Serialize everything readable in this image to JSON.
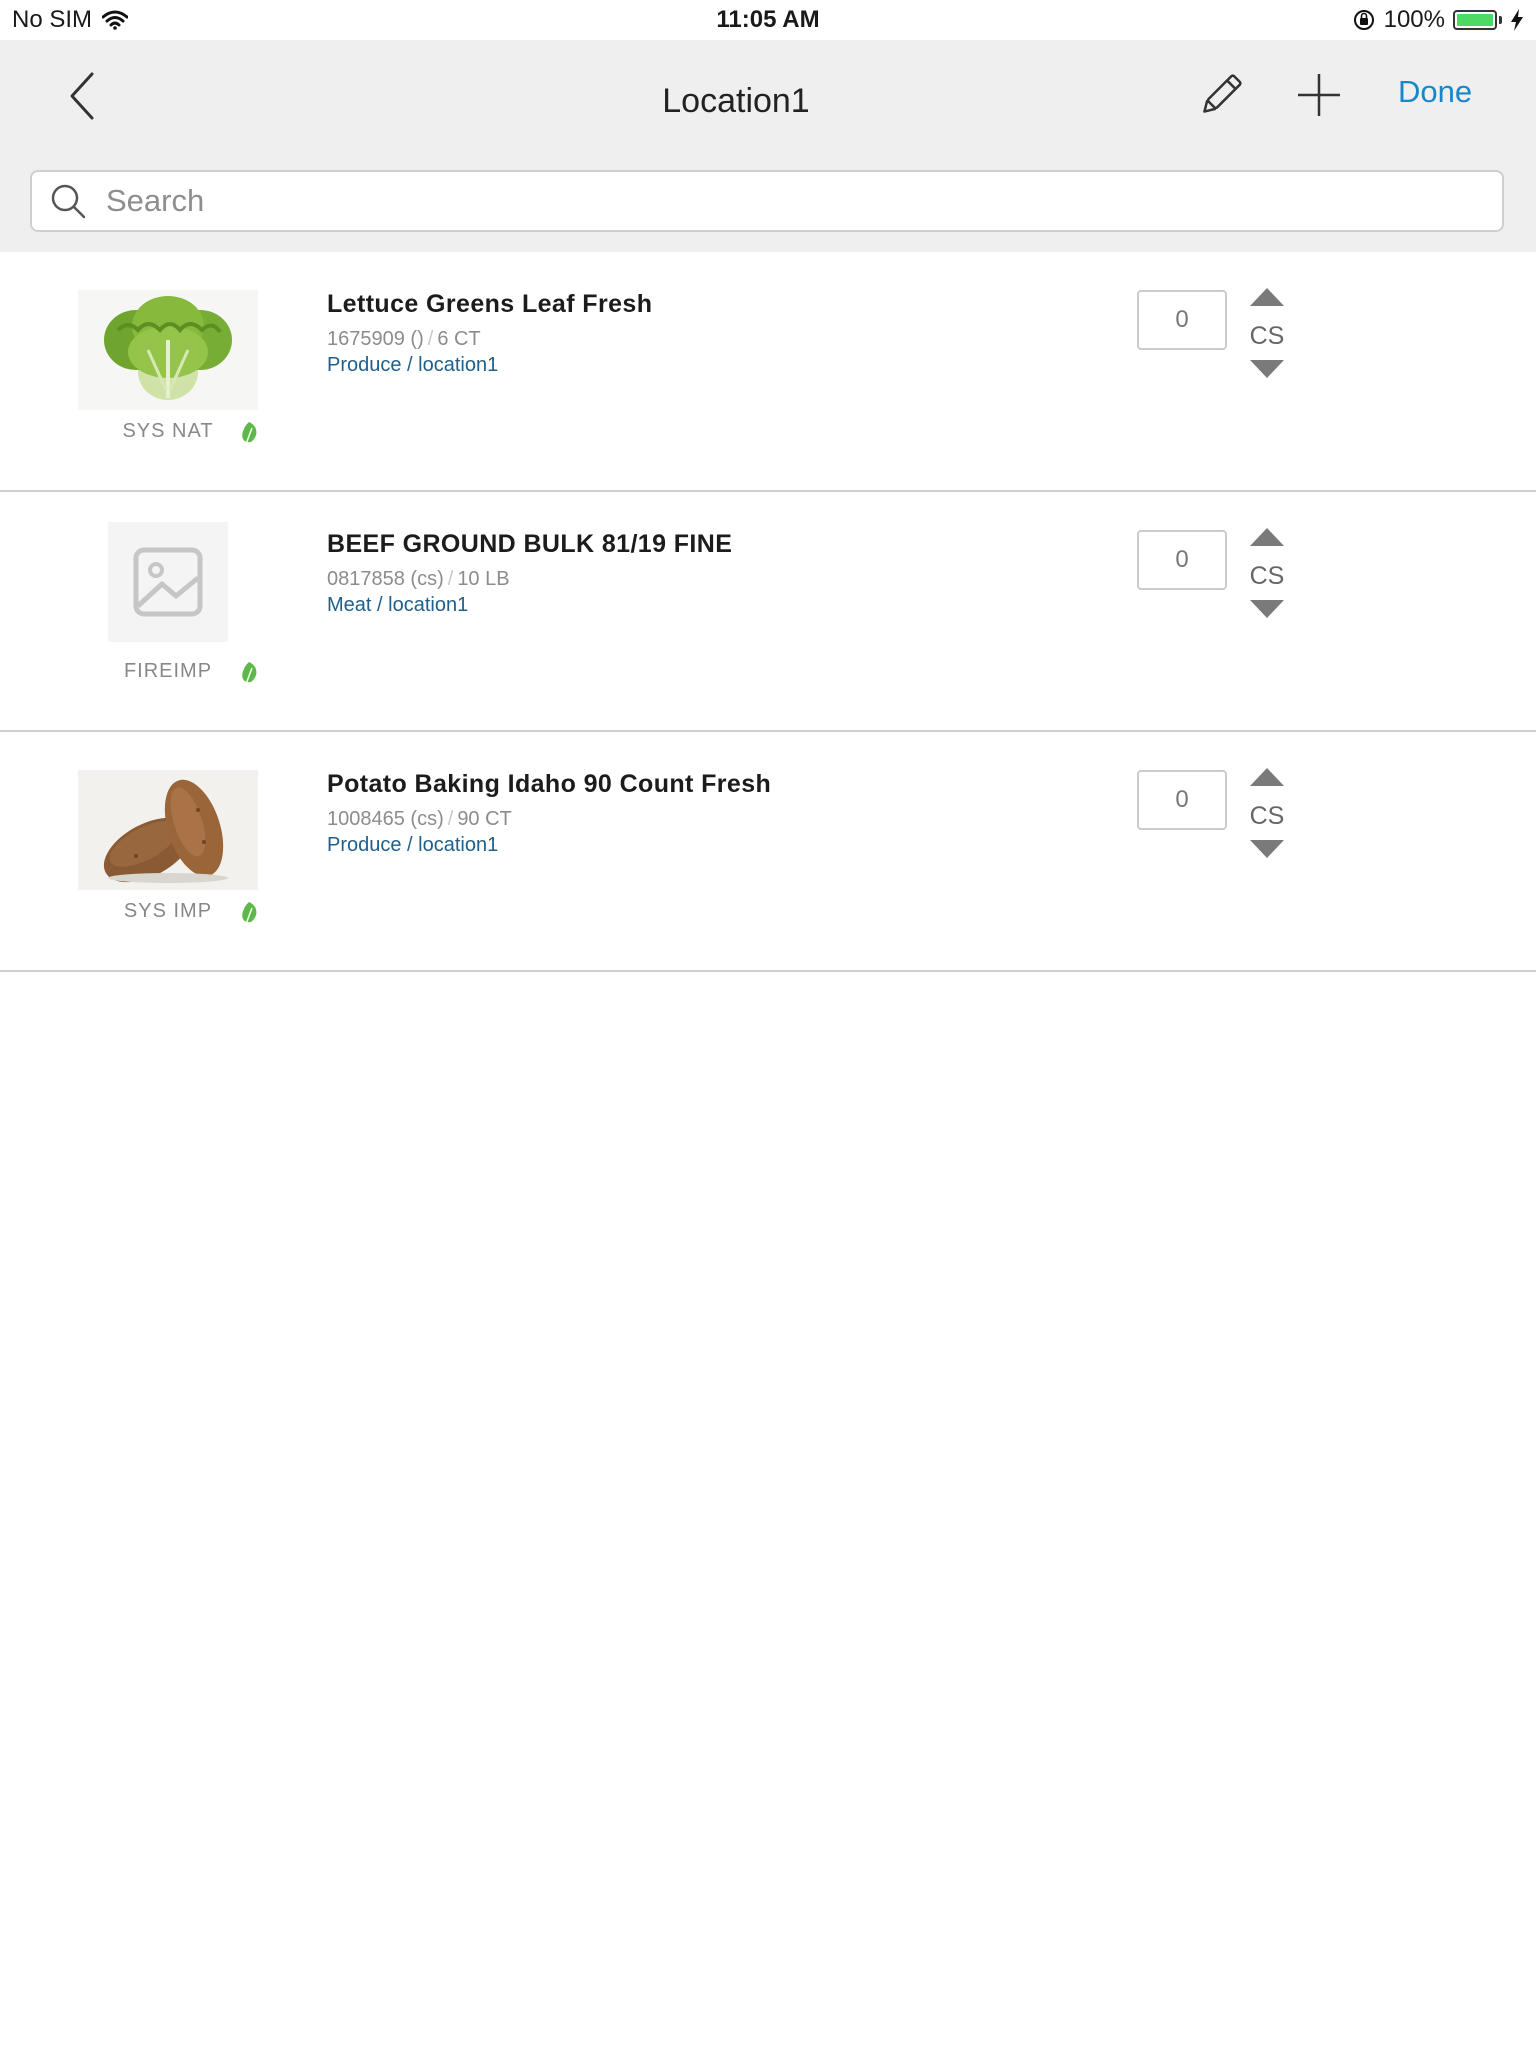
{
  "status_bar": {
    "carrier": "No SIM",
    "time": "11:05 AM",
    "battery": "100%",
    "battery_level": 1.0
  },
  "nav": {
    "title": "Location1",
    "done_label": "Done"
  },
  "search": {
    "placeholder": "Search",
    "value": ""
  },
  "items": [
    {
      "name": "Lettuce Greens Leaf Fresh",
      "code": "1675909 ()",
      "pack": "6 CT",
      "category": "Produce / location1",
      "brand": "SYS NAT",
      "quantity": "0",
      "unit": "CS",
      "image": "lettuce"
    },
    {
      "name": "BEEF GROUND BULK 81/19 FINE",
      "code": "0817858 (cs)",
      "pack": "10 LB",
      "category": "Meat / location1",
      "brand": "FIREIMP",
      "quantity": "0",
      "unit": "CS",
      "image": "placeholder"
    },
    {
      "name": "Potato Baking Idaho 90 Count Fresh",
      "code": "1008465 (cs)",
      "pack": "90 CT",
      "category": "Produce / location1",
      "brand": "SYS IMP",
      "quantity": "0",
      "unit": "CS",
      "image": "potato"
    }
  ],
  "colors": {
    "accent": "#1a86c8",
    "category_link": "#1f5f8b",
    "leaf_green": "#5cb848",
    "nav_background": "#efefef"
  }
}
